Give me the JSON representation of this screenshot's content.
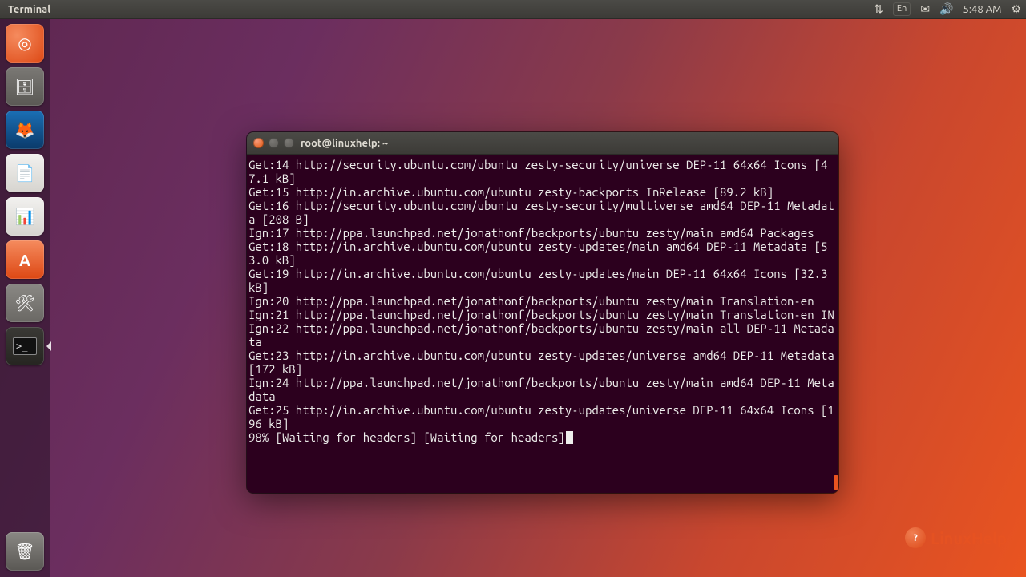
{
  "topbar": {
    "app_title": "Terminal",
    "lang": "En",
    "time": "5:48 AM"
  },
  "launcher": {
    "ubuntu": "◎",
    "files": "🗄",
    "firefox": "🦊",
    "writer": "📄",
    "impress": "📊",
    "software": "A",
    "settings": "🛠",
    "terminal_prompt": ">_",
    "trash": "🗑"
  },
  "window": {
    "title": "root@linuxhelp: ~"
  },
  "terminal": {
    "lines": [
      "Get:14 http://security.ubuntu.com/ubuntu zesty-security/universe DEP-11 64x64 Icons [47.1 kB]",
      "Get:15 http://in.archive.ubuntu.com/ubuntu zesty-backports InRelease [89.2 kB]",
      "Get:16 http://security.ubuntu.com/ubuntu zesty-security/multiverse amd64 DEP-11 Metadata [208 B]",
      "Ign:17 http://ppa.launchpad.net/jonathonf/backports/ubuntu zesty/main amd64 Packages",
      "Get:18 http://in.archive.ubuntu.com/ubuntu zesty-updates/main amd64 DEP-11 Metadata [53.0 kB]",
      "Get:19 http://in.archive.ubuntu.com/ubuntu zesty-updates/main DEP-11 64x64 Icons [32.3 kB]",
      "Ign:20 http://ppa.launchpad.net/jonathonf/backports/ubuntu zesty/main Translation-en",
      "Ign:21 http://ppa.launchpad.net/jonathonf/backports/ubuntu zesty/main Translation-en_IN",
      "Ign:22 http://ppa.launchpad.net/jonathonf/backports/ubuntu zesty/main all DEP-11 Metadata",
      "Get:23 http://in.archive.ubuntu.com/ubuntu zesty-updates/universe amd64 DEP-11 Metadata [172 kB]",
      "Ign:24 http://ppa.launchpad.net/jonathonf/backports/ubuntu zesty/main amd64 DEP-11 Metadata",
      "Get:25 http://in.archive.ubuntu.com/ubuntu zesty-updates/universe DEP-11 64x64 Icons [196 kB]"
    ],
    "progress": "98% [Waiting for headers] [Waiting for headers]"
  },
  "watermark": {
    "text": "LinuxHelp"
  }
}
